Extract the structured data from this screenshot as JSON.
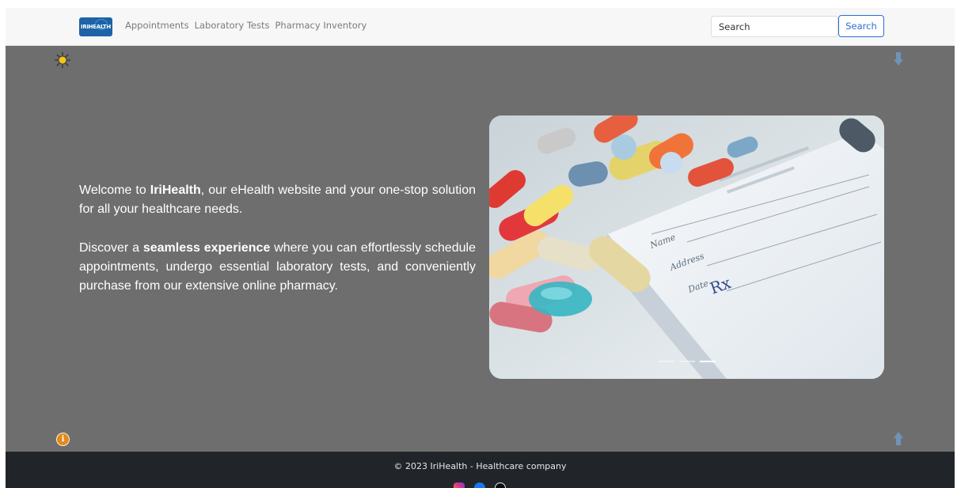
{
  "brand": {
    "logo_text": "IRIHEALTH"
  },
  "nav": {
    "links": [
      "Appointments",
      "Laboratory Tests",
      "Pharmacy Inventory"
    ],
    "search_placeholder": "Search",
    "search_button": "Search"
  },
  "intro": {
    "p1_before": "Welcome to ",
    "p1_bold": "IriHealth",
    "p1_after": ", our eHealth website and your one-stop solution for all your healthcare needs.",
    "p2_before": "Discover a ",
    "p2_bold": "seamless experience",
    "p2_after": " where you can effortlessly schedule appointments, undergo essential laboratory tests, and conveniently purchase from our extensive online pharmacy."
  },
  "hero": {
    "form_labels": [
      "Name",
      "Address",
      "Date"
    ],
    "rx_symbol": "Rx"
  },
  "footer": {
    "copyright": "© 2023 IriHealth - Healthcare company"
  },
  "icons": [
    "sun-icon",
    "scroll-down-icon",
    "scroll-up-icon",
    "info-icon",
    "instagram-icon",
    "facebook-icon",
    "github-icon"
  ],
  "colors": {
    "accent": "#2c6fd1",
    "background": "#6e6e6e",
    "navbar": "#f7f7f7",
    "footer": "#212529",
    "brand": "#1e63a6"
  }
}
